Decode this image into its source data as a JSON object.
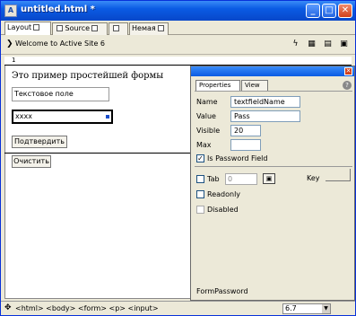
{
  "window": {
    "title": "untitled.html *",
    "icon": "app-icon",
    "minimize_glyph": "_",
    "maximize_glyph": "□",
    "close_glyph": "✕"
  },
  "tabs": [
    {
      "label": "Layout"
    },
    {
      "label": "Source"
    },
    {
      "label": ""
    },
    {
      "label": "Немая"
    }
  ],
  "toolbar": {
    "page_title": "Welcome to Active Site 6",
    "arrow_glyph": "❯",
    "tool1_glyph": "ϟ",
    "tool2_glyph": "▦",
    "tool3_glyph": "▤",
    "tool4_glyph": "▣"
  },
  "document": {
    "ruler_mark": "1",
    "heading": "Это пример простейшей формы",
    "text_field_value": "Текстовое поле",
    "password_value": "xxxx",
    "submit_label": "Подтвердить",
    "reset_label": "Очистить"
  },
  "inspector": {
    "tabs": [
      "Properties",
      "View"
    ],
    "name_label": "Name",
    "name_value": "textfieldName",
    "value_label": "Value",
    "value_value": "Pass",
    "visible_label": "Visible",
    "visible_value": "20",
    "max_label": "Max",
    "max_value": "",
    "password_field_label": "Is Password Field",
    "password_field_checked": true,
    "tab_label": "Tab",
    "tab_value": "0",
    "key_label": "Key",
    "readonly_label": "Readonly",
    "disabled_label": "Disabled",
    "footer_label": "FormPassword"
  },
  "statusbar": {
    "path": "<html> <body> <form> <p> <input>",
    "zoom": "6.7"
  },
  "colors": {
    "titlebar": "#0a5be3",
    "accent": "#1b4ecb"
  }
}
